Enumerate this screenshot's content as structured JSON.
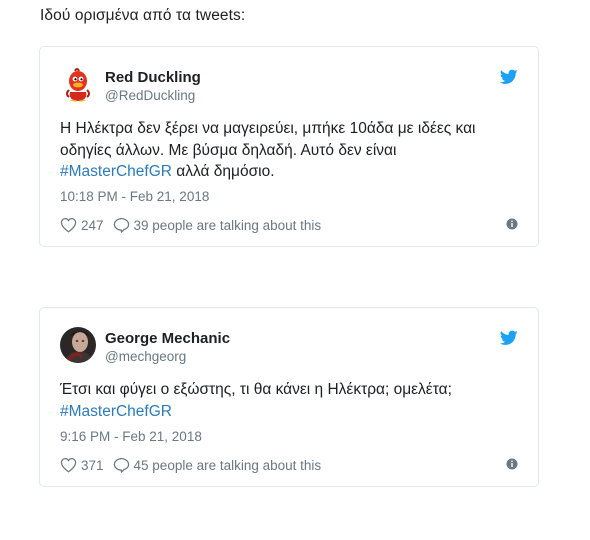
{
  "intro_text": "Ιδού ορισμένα από τα tweets:",
  "tweets": [
    {
      "name": "Red Duckling",
      "handle": "@RedDuckling",
      "text_lines": [
        "Η Ηλέκτρα δεν ξέρει να μαγειρεύει, μπήκε 10άδα με ιδέες και",
        "οδηγίες άλλων. Με βύσμα δηλαδή. Αυτό δεν είναι"
      ],
      "hashtag": "#MasterChefGR",
      "hashtag_suffix": " αλλά δημόσιο.",
      "time": "10:18 PM - Feb 21, 2018",
      "likes": "247",
      "talking": "39 people are talking about this"
    },
    {
      "name": "George Mechanic",
      "handle": "@mechgeorg",
      "text_lines": [
        "Έτσι και φύγει ο εξώστης, τι θα κάνει η Ηλέκτρα; ομελέτα;"
      ],
      "hashtag": "#MasterChefGR",
      "hashtag_suffix": "",
      "time": "9:16 PM - Feb 21, 2018",
      "likes": "371",
      "talking": "45 people are talking about this"
    }
  ],
  "colors": {
    "link": "#2b7bb9",
    "twitter_blue": "#1da1f2",
    "muted": "#697882",
    "border": "#e1e8ed"
  },
  "icons": {
    "brand": "twitter-bird-icon",
    "like": "heart-icon",
    "reply": "speech-bubble-icon",
    "info": "info-icon"
  }
}
